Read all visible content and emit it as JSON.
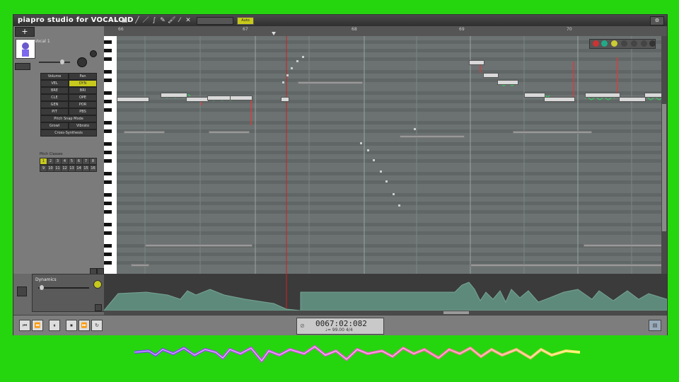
{
  "app": {
    "title": "piapro studio for VOCALOID",
    "settings_label": "⚙"
  },
  "toolbar": {
    "snap_label": "Auto"
  },
  "track": {
    "name": "Vocal 1",
    "buttons": [
      "Volume",
      "Pan",
      "VEL",
      "DYN",
      "BRE",
      "BRI",
      "CLE",
      "OPE",
      "GEN",
      "POR",
      "PIT",
      "PBS"
    ],
    "pitch_snap_mode": "Pitch Snap Mode",
    "growl": "Growl",
    "vibrato": "Vibrato",
    "cross_synthesis": "Cross-Synthesis",
    "pitch_class_label": "Pitch Classes",
    "pitch_classes": [
      "1",
      "2",
      "3",
      "4",
      "5",
      "6",
      "7",
      "8",
      "9",
      "10",
      "11",
      "12",
      "13",
      "14",
      "15",
      "16"
    ]
  },
  "ruler": {
    "measures": [
      "66",
      "67",
      "68",
      "69",
      "70"
    ]
  },
  "dynamics": {
    "label": "Dynamics"
  },
  "transport": {
    "time": "0067:02:082",
    "tempo": "♩= 99.00   4/4"
  },
  "colors": {
    "accent": "#c7c91c",
    "background": "#25d60e",
    "roll": "#6c7272"
  }
}
